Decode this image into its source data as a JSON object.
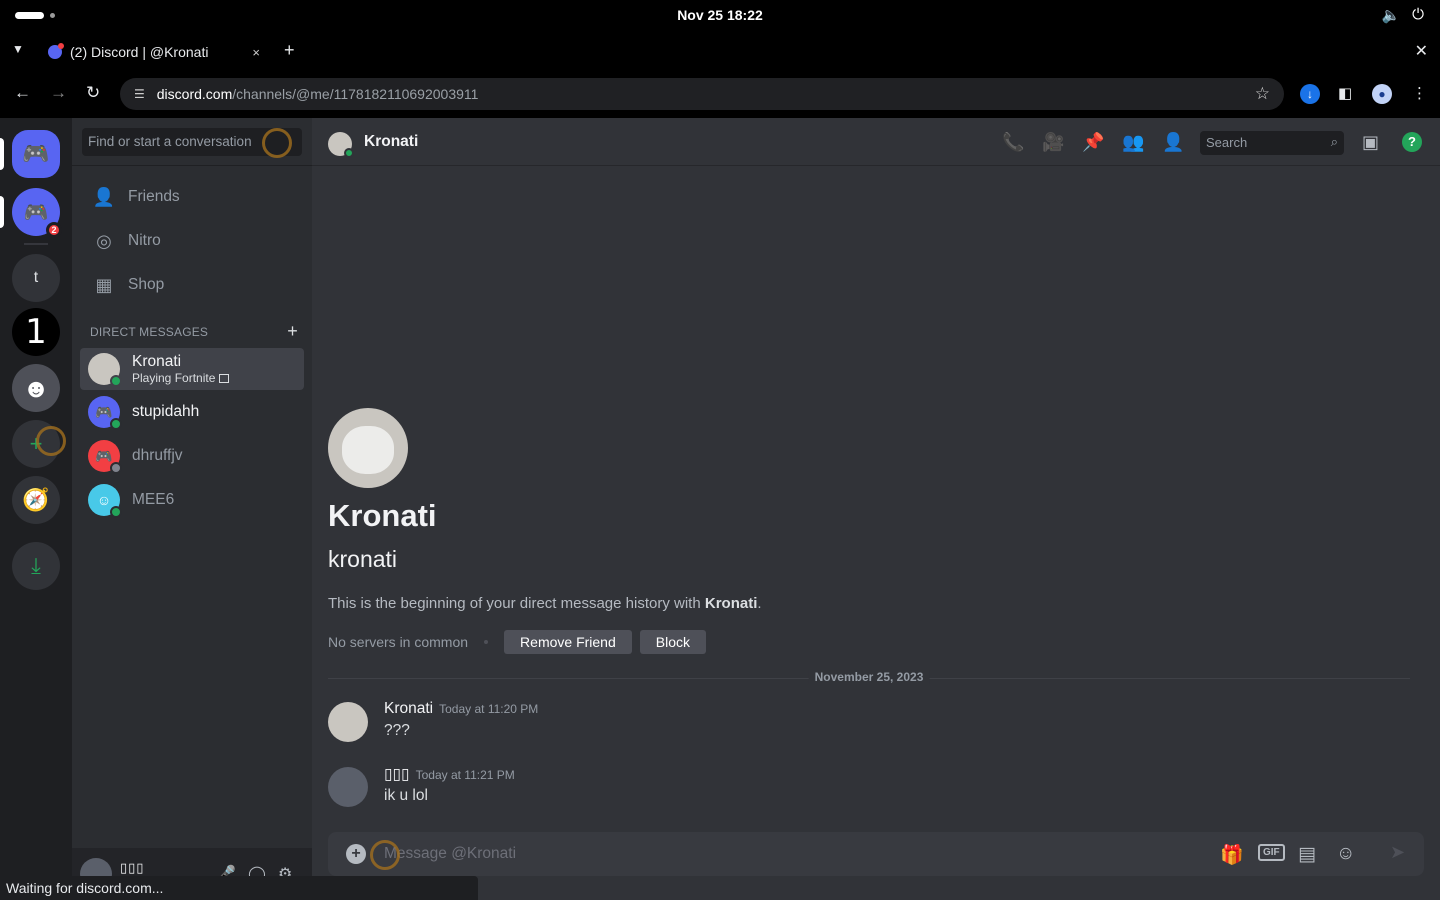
{
  "os": {
    "clock": "Nov 25  18:22",
    "volume_icon": "🔈",
    "power_icon": "⏻"
  },
  "browser": {
    "tab_title": "(2) Discord | @Kronati",
    "tab_close": "×",
    "new_tab": "+",
    "window_close": "✕",
    "url_host": "discord.com",
    "url_path": "/channels/@me/1178182110692003911",
    "back": "←",
    "forward": "→",
    "reload": "↻",
    "bookmark_star": "☆",
    "menu": "⋮"
  },
  "guilds": {
    "tooltip": "stupidahh",
    "server_t_label": "t",
    "server_one_label": "1",
    "mention_count": "2"
  },
  "sidebar": {
    "search_placeholder": "Find or start a conversation",
    "nav": [
      {
        "label": "Friends",
        "icon": "friends-icon"
      },
      {
        "label": "Nitro",
        "icon": "nitro-icon"
      },
      {
        "label": "Shop",
        "icon": "shop-icon"
      }
    ],
    "dm_header": "DIRECT MESSAGES",
    "dm_add": "+",
    "dms": [
      {
        "name": "Kronati",
        "sub": "Playing Fortnite",
        "status": "online"
      },
      {
        "name": "stupidahh",
        "sub": "",
        "status": "online"
      },
      {
        "name": "dhruffjv",
        "sub": "",
        "status": "offline"
      },
      {
        "name": "MEE6",
        "sub": "",
        "status": "online"
      }
    ],
    "user_name": "▯▯▯"
  },
  "chat": {
    "header_name": "Kronati",
    "search_placeholder": "Search",
    "help": "?",
    "welcome_name": "Kronati",
    "welcome_username": "kronati",
    "welcome_desc_prefix": "This is the beginning of your direct message history with ",
    "welcome_desc_name": "Kronati",
    "welcome_desc_suffix": ".",
    "no_common": "No servers in common",
    "remove_friend": "Remove Friend",
    "block": "Block",
    "date_divider": "November 25, 2023",
    "messages": [
      {
        "author": "Kronati",
        "time": "Today at 11:20 PM",
        "body": "???"
      },
      {
        "author": "▯▯▯",
        "time": "Today at 11:21 PM",
        "body": "ik u lol"
      }
    ],
    "composer_placeholder": "Message @Kronati",
    "gif_label": "GIF"
  },
  "status_bar": "Waiting for discord.com..."
}
